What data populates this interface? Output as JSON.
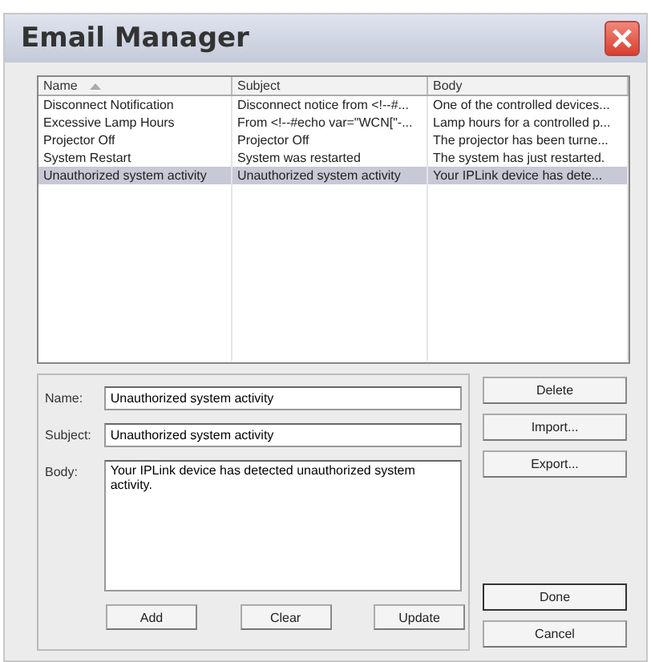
{
  "window": {
    "title": "Email Manager"
  },
  "table": {
    "columns": [
      {
        "label": "Name",
        "sorted": true
      },
      {
        "label": "Subject",
        "sorted": false
      },
      {
        "label": "Body",
        "sorted": false
      }
    ],
    "rows": [
      {
        "cells": [
          "Disconnect Notification",
          "Disconnect notice from <!--#...",
          "One of the controlled devices..."
        ],
        "selected": false
      },
      {
        "cells": [
          "Excessive Lamp Hours",
          "From <!--#echo var=\"WCN[\"-...",
          "Lamp hours for a controlled p..."
        ],
        "selected": false
      },
      {
        "cells": [
          "Projector Off",
          "Projector Off",
          "The projector has been turne..."
        ],
        "selected": false
      },
      {
        "cells": [
          "System Restart",
          "System was restarted",
          "The system has just restarted."
        ],
        "selected": false
      },
      {
        "cells": [
          "Unauthorized system activity",
          "Unauthorized system activity",
          "Your IPLink device has dete..."
        ],
        "selected": true
      }
    ]
  },
  "form": {
    "name_label": "Name:",
    "name_value": "Unauthorized system activity",
    "subject_label": "Subject:",
    "subject_value": "Unauthorized system activity",
    "body_label": "Body:",
    "body_value": "Your IPLink device has detected unauthorized system activity.",
    "buttons": [
      "Add",
      "Clear",
      "Update"
    ]
  },
  "side_buttons": [
    {
      "label": "Delete",
      "default": false
    },
    {
      "label": "Import...",
      "default": false
    },
    {
      "label": "Export...",
      "default": false
    }
  ],
  "bottom_buttons": [
    {
      "label": "Done",
      "default": true
    },
    {
      "label": "Cancel",
      "default": false
    }
  ]
}
